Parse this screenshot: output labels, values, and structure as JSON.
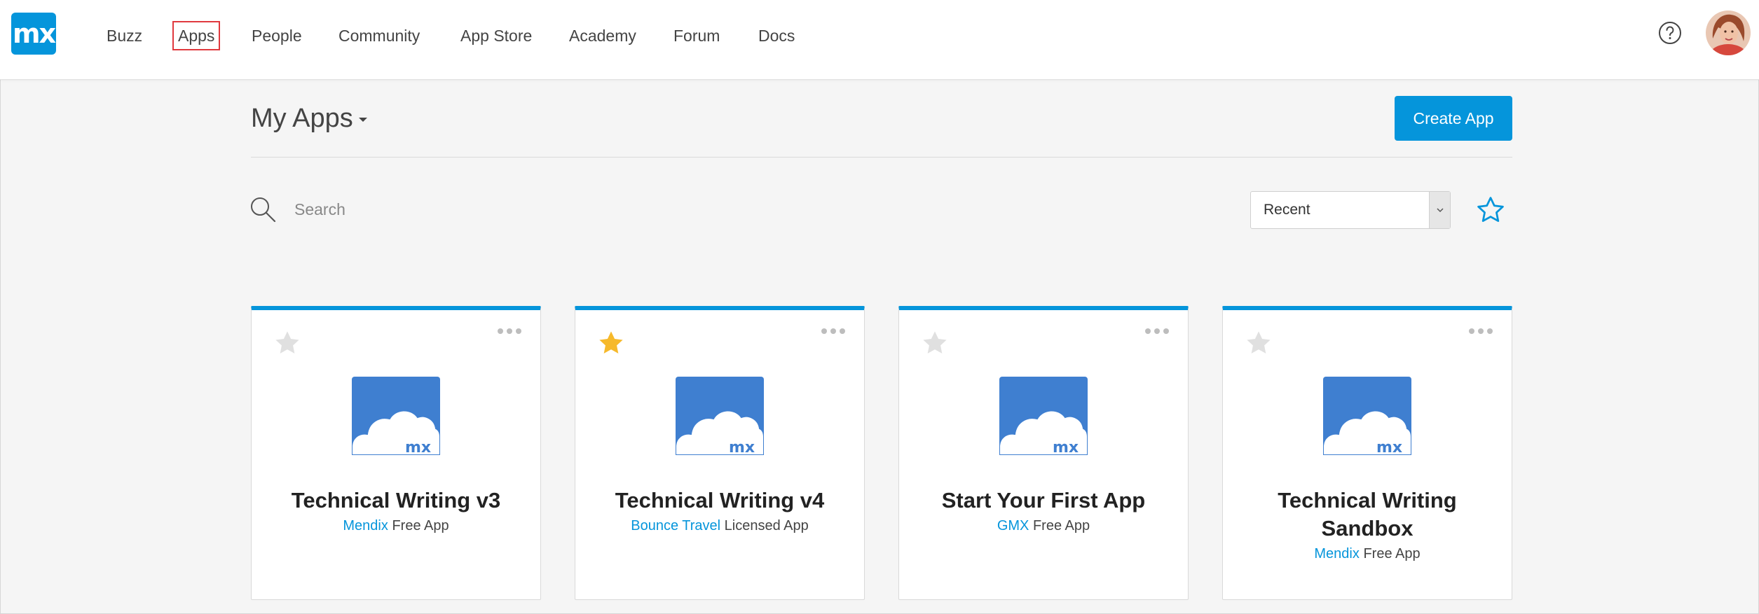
{
  "nav": {
    "logo": "mx",
    "items": [
      {
        "label": "Buzz",
        "active": false
      },
      {
        "label": "Apps",
        "active": true
      },
      {
        "label": "People",
        "active": false
      },
      {
        "label": "Community",
        "active": false
      },
      {
        "label": "App Store",
        "active": false
      },
      {
        "label": "Academy",
        "active": false
      },
      {
        "label": "Forum",
        "active": false
      },
      {
        "label": "Docs",
        "active": false
      }
    ],
    "help_icon": "question-circle-icon",
    "avatar": "user-avatar"
  },
  "header": {
    "title": "My Apps",
    "create_button": "Create App"
  },
  "toolbar": {
    "search_placeholder": "Search",
    "sort_value": "Recent",
    "favorite_filter_icon": "star-outline-icon"
  },
  "colors": {
    "accent": "#0595db",
    "star_active": "#f6b92b",
    "star_inactive": "#e0e0e0",
    "app_icon_bg": "#3f7fd0"
  },
  "apps": [
    {
      "title": "Technical Writing v3",
      "company": "Mendix",
      "license": "Free App",
      "favorite": false
    },
    {
      "title": "Technical Writing v4",
      "company": "Bounce Travel",
      "license": "Licensed App",
      "favorite": true
    },
    {
      "title": "Start Your First App",
      "company": "GMX",
      "license": "Free App",
      "favorite": false
    },
    {
      "title": "Technical Writing Sandbox",
      "company": "Mendix",
      "license": "Free App",
      "favorite": false
    }
  ]
}
